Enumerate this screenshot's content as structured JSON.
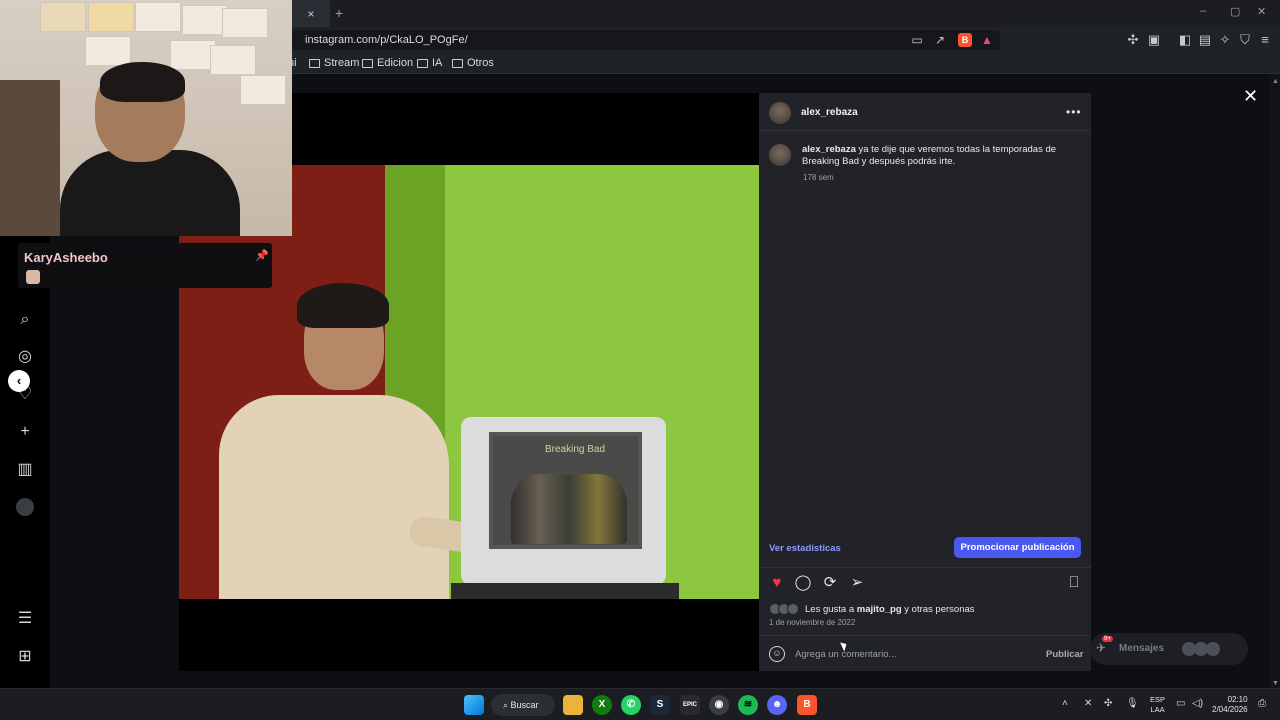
{
  "browser": {
    "tab_close": "×",
    "new_tab": "+",
    "url": "instagram.com/p/CkaLO_POgFe/",
    "window_controls": [
      "–",
      "▢",
      "✕"
    ],
    "bookmarks": [
      {
        "label": "ni",
        "folder": false
      },
      {
        "label": "Stream",
        "folder": true
      },
      {
        "label": "Edicion",
        "folder": true
      },
      {
        "label": "IA",
        "folder": true
      },
      {
        "label": "Otros",
        "folder": true
      }
    ]
  },
  "post": {
    "username": "alex_rebaza",
    "more": "•••",
    "caption_user": "alex_rebaza",
    "caption_text": " ya te dije que veremos todas la temporadas de Breaking Bad y después podrás irte.",
    "caption_time": "178 sem",
    "tv_title": "Breaking Bad",
    "stats_link": "Ver estadísticas",
    "promote_button": "Promocionar publicación",
    "likes_prefix": "Les gusta a ",
    "likes_user": "majito_pg",
    "likes_suffix": " y otras personas",
    "date": "1 de noviembre de 2022",
    "comment_placeholder": "Agrega un comentario...",
    "publish": "Publicar",
    "liked_color": "#ff3040"
  },
  "messages": {
    "label": "Mensajes",
    "badge": "9+"
  },
  "overlay": {
    "chat_user": "KaryAsheebo"
  },
  "taskbar": {
    "search": "Buscar",
    "lang_top": "ESP",
    "lang_bottom": "LAA",
    "time": "02:10",
    "date": "2/04/2026"
  }
}
